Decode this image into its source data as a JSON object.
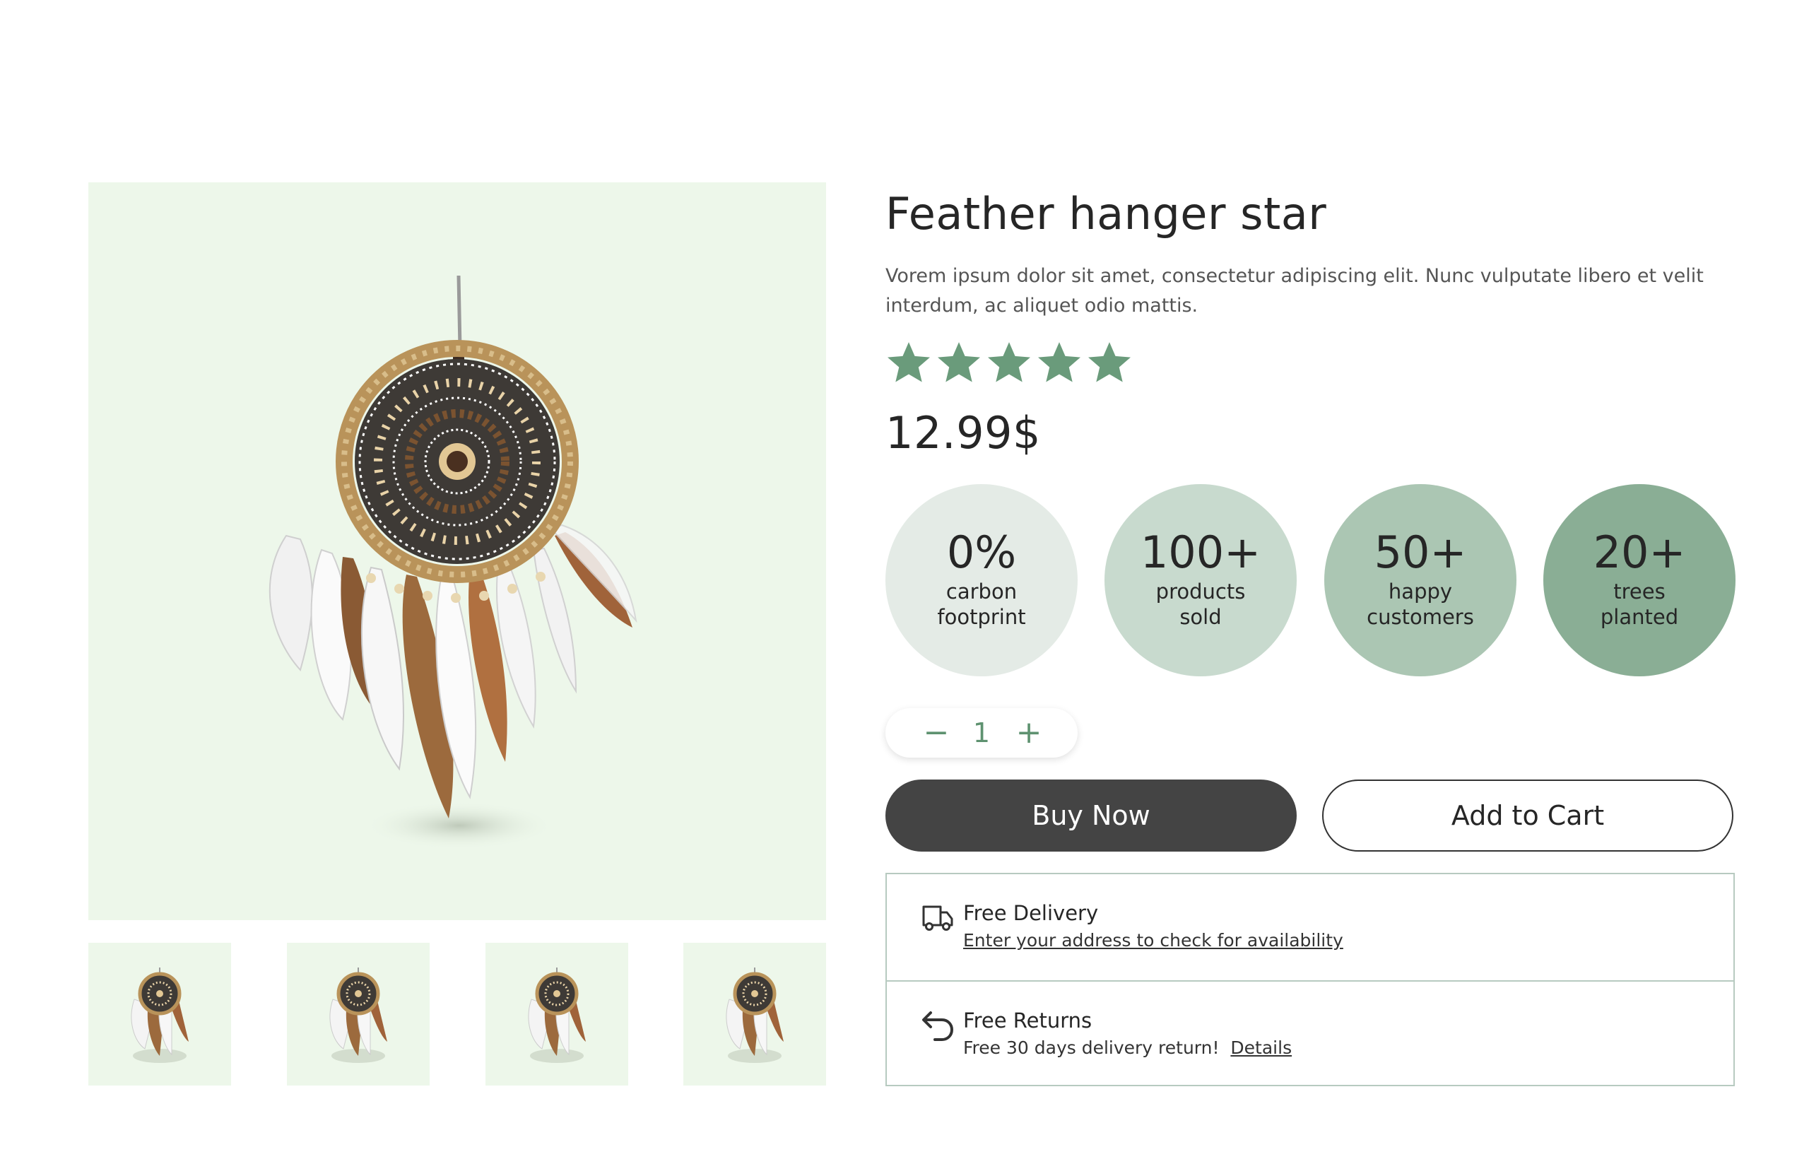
{
  "product": {
    "title": "Feather hanger star",
    "description": "Vorem ipsum dolor sit amet, consectetur adipiscing elit. Nunc vulputate libero et velit interdum, ac aliquet odio mattis.",
    "rating": 5,
    "rating_max": 5,
    "price": "12.99$"
  },
  "gallery": {
    "background_color": "#edf7ea",
    "thumbnail_count": 4
  },
  "stats": [
    {
      "value": "0%",
      "label": "carbon footprint",
      "color": "#e4ebe6"
    },
    {
      "value": "100+",
      "label": "products sold",
      "color": "#c8dace"
    },
    {
      "value": "50+",
      "label": "happy customers",
      "color": "#abc6b3"
    },
    {
      "value": "20+",
      "label": "trees planted",
      "color": "#8aae95"
    }
  ],
  "quantity": {
    "value": "1",
    "decrement_label": "−",
    "increment_label": "+"
  },
  "actions": {
    "buy_now": "Buy Now",
    "add_to_cart": "Add to Cart"
  },
  "shipping": {
    "delivery_title": "Free Delivery",
    "delivery_link": "Enter your address to check for availability",
    "returns_title": "Free Returns",
    "returns_text": "Free 30 days delivery return!",
    "returns_link": "Details"
  },
  "colors": {
    "star": "#6a9b7b",
    "accent_green": "#5e9270",
    "dark_button": "#444444",
    "border": "#b7cac0"
  },
  "icons": {
    "delivery": "truck-icon",
    "returns": "return-arrow-icon",
    "rating": "star-icon"
  }
}
